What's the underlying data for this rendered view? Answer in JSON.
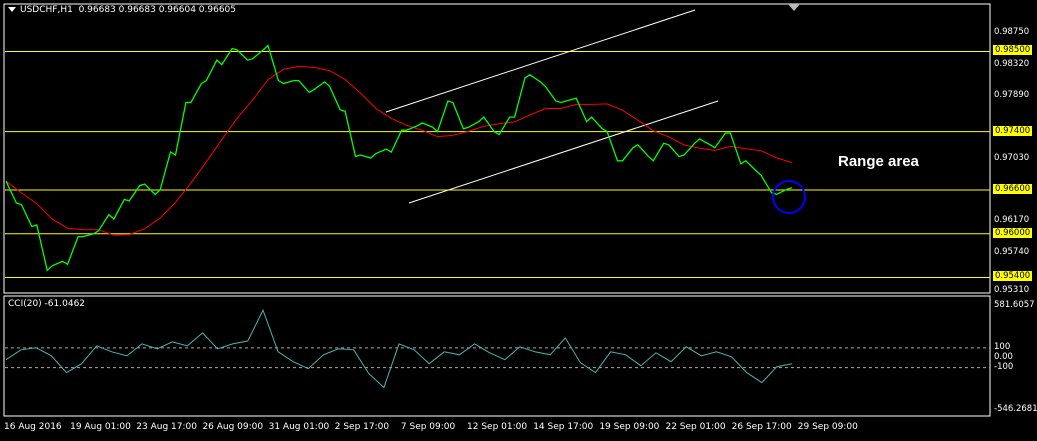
{
  "header": {
    "symbol_label": "USDCHF,H1",
    "ohlc": "0.96683 0.96683 0.96604 0.96605"
  },
  "indicator": {
    "label": "CCI(20) -61.0462",
    "axis_labels": [
      "581.6057",
      "100",
      "0.00",
      "-100",
      "-546.2681"
    ]
  },
  "price_axis": {
    "plain_labels": [
      "0.98750",
      "0.98320",
      "0.97890",
      "0.97030",
      "0.96170",
      "0.95740",
      "0.95310"
    ],
    "highlighted_labels": [
      "0.98500",
      "0.97400",
      "0.96600",
      "0.96000",
      "0.95400"
    ]
  },
  "date_axis": [
    "16 Aug 2016",
    "19 Aug 01:00",
    "23 Aug 17:00",
    "26 Aug 09:00",
    "31 Aug 01:00",
    "2 Sep 17:00",
    "7 Sep 09:00",
    "12 Sep 01:00",
    "14 Sep 17:00",
    "19 Sep 09:00",
    "22 Sep 01:00",
    "26 Sep 17:00",
    "29 Sep 09:00"
  ],
  "annotation": {
    "text": "Range area"
  },
  "colors": {
    "background": "#000000",
    "price_line": "#00ff00",
    "moving_average": "#ff0000",
    "horizontal_levels": "#ffff00",
    "channel_lines": "#ffffff",
    "cci_line": "#4fb3b3",
    "circle": "#0000ff"
  },
  "chart_data": [
    {
      "type": "line",
      "title": "USDCHF,H1",
      "series": [
        {
          "name": "USDCHF,H1",
          "values": [
            0.9672,
            0.964,
            0.9612,
            0.9556,
            0.9558,
            0.9596,
            0.9604,
            0.962,
            0.9645,
            0.9668,
            0.966,
            0.9708,
            0.978,
            0.981,
            0.9832,
            0.9852,
            0.984,
            0.9858,
            0.9806,
            0.981,
            0.9798,
            0.9802,
            0.9768,
            0.9708,
            0.971,
            0.9712,
            0.9742,
            0.9752,
            0.974,
            0.978,
            0.9746,
            0.976,
            0.9736,
            0.976,
            0.9818,
            0.9802,
            0.978,
            0.9786,
            0.976,
            0.974,
            0.97,
            0.9722,
            0.97,
            0.9722,
            0.9708,
            0.973,
            0.9718,
            0.9738,
            0.97,
            0.968,
            0.9654,
            0.9663
          ]
        }
      ],
      "horizontal_levels": [
        0.985,
        0.974,
        0.966,
        0.96,
        0.954
      ],
      "ylim": [
        0.9531,
        0.99
      ]
    },
    {
      "type": "line",
      "title": "CCI(20) -61.0462",
      "series": [
        {
          "name": "CCI(20)",
          "values": [
            -20,
            80,
            100,
            20,
            -150,
            -60,
            120,
            60,
            20,
            140,
            90,
            160,
            120,
            250,
            90,
            140,
            170,
            480,
            60,
            -40,
            -110,
            30,
            90,
            80,
            -160,
            -300,
            140,
            80,
            -60,
            60,
            30,
            140,
            50,
            -20,
            110,
            60,
            30,
            200,
            -50,
            -150,
            60,
            30,
            -80,
            50,
            -40,
            110,
            20,
            60,
            10,
            -150,
            -250,
            -90,
            -60
          ]
        }
      ],
      "reference_levels": [
        100,
        0,
        -100
      ],
      "ylim": [
        -546.2681,
        581.6057
      ]
    }
  ]
}
